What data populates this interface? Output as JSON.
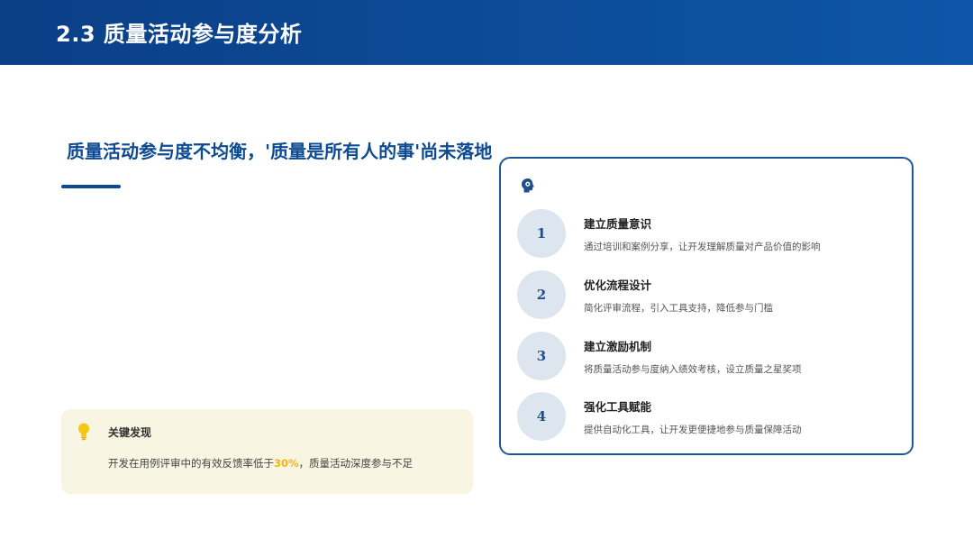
{
  "header": {
    "title": "2.3 质量活动参与度分析"
  },
  "main": {
    "subtitle": "质量活动参与度不均衡，'质量是所有人的事'尚未落地"
  },
  "finding": {
    "icon": "lightbulb-icon",
    "title": "关键发现",
    "text_before": "开发在用例评审中的有效反馈率低于",
    "highlight": "30%",
    "text_after": "，质量活动深度参与不足"
  },
  "card": {
    "icon": "brain-gear-icon",
    "steps": [
      {
        "number": "1",
        "title": "建立质量意识",
        "desc": "通过培训和案例分享，让开发理解质量对产品价值的影响"
      },
      {
        "number": "2",
        "title": "优化流程设计",
        "desc": "简化评审流程，引入工具支持，降低参与门槛"
      },
      {
        "number": "3",
        "title": "建立激励机制",
        "desc": "将质量活动参与度纳入绩效考核，设立质量之星奖项"
      },
      {
        "number": "4",
        "title": "强化工具赋能",
        "desc": "提供自动化工具，让开发更便捷地参与质量保障活动"
      }
    ]
  },
  "colors": {
    "header": "#0c4a92",
    "accent": "#0c4a92",
    "highlight": "#f2b519",
    "finding_bg": "#f8f5e2",
    "circle_bg": "#dde5ee"
  }
}
